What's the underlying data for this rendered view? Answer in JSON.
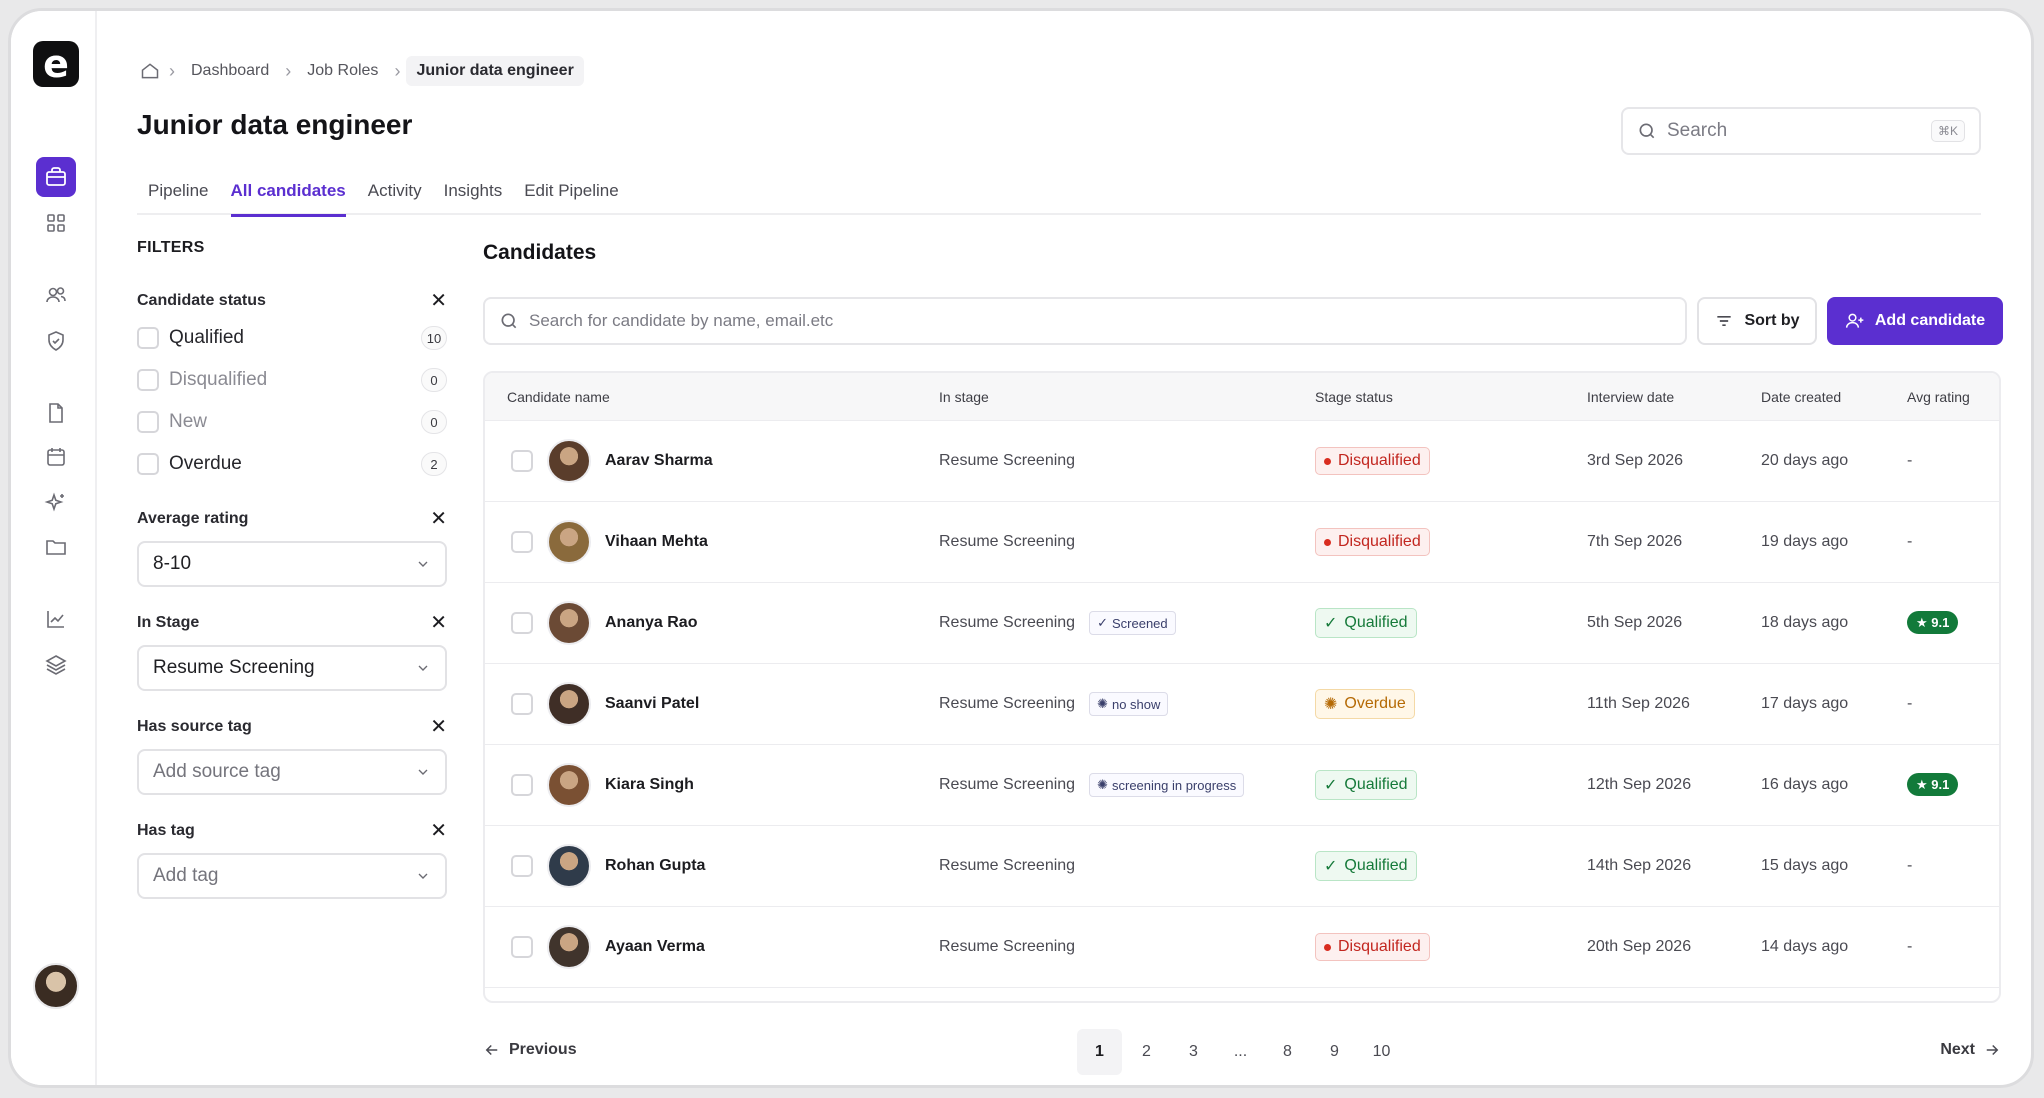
{
  "breadcrumb": {
    "items": [
      "Dashboard",
      "Job Roles",
      "Junior data engineer"
    ]
  },
  "page_title": "Junior data engineer",
  "search": {
    "placeholder": "Search",
    "shortcut": "⌘K"
  },
  "tabs": [
    "Pipeline",
    "All candidates",
    "Activity",
    "Insights",
    "Edit Pipeline"
  ],
  "active_tab": "All candidates",
  "filters": {
    "title": "FILTERS",
    "candidate_status": {
      "label": "Candidate status",
      "options": [
        {
          "label": "Qualified",
          "count": "10"
        },
        {
          "label": "Disqualified",
          "count": "0"
        },
        {
          "label": "New",
          "count": "0"
        },
        {
          "label": "Overdue",
          "count": "2"
        }
      ]
    },
    "average_rating": {
      "label": "Average rating",
      "value": "8-10"
    },
    "in_stage": {
      "label": "In Stage",
      "value": "Resume Screening"
    },
    "source_tag": {
      "label": "Has source tag",
      "placeholder": "Add source tag"
    },
    "tag": {
      "label": "Has tag",
      "placeholder": "Add tag"
    }
  },
  "candidates": {
    "title": "Candidates",
    "search_placeholder": "Search for candidate by name, email.etc",
    "sort_label": "Sort by",
    "add_label": "Add candidate",
    "columns": [
      "Candidate name",
      "In stage",
      "Stage status",
      "Interview date",
      "Date created",
      "Avg rating"
    ],
    "rows": [
      {
        "name": "Aarav Sharma",
        "stage": "Resume Screening",
        "tag": "",
        "status": "Disqualified",
        "interview": "3rd Sep 2026",
        "created": "20 days ago",
        "rating": "-"
      },
      {
        "name": "Vihaan Mehta",
        "stage": "Resume Screening",
        "tag": "",
        "status": "Disqualified",
        "interview": "7th Sep 2026",
        "created": "19 days ago",
        "rating": "-"
      },
      {
        "name": "Ananya Rao",
        "stage": "Resume Screening",
        "tag": "Screened",
        "status": "Qualified",
        "interview": "5th Sep 2026",
        "created": "18 days ago",
        "rating": "9.1"
      },
      {
        "name": "Saanvi Patel",
        "stage": "Resume Screening",
        "tag": "no show",
        "status": "Overdue",
        "interview": "11th Sep 2026",
        "created": "17 days ago",
        "rating": "-"
      },
      {
        "name": "Kiara Singh",
        "stage": "Resume Screening",
        "tag": "screening in progress",
        "status": "Qualified",
        "interview": "12th Sep 2026",
        "created": "16 days ago",
        "rating": "9.1"
      },
      {
        "name": "Rohan Gupta",
        "stage": "Resume Screening",
        "tag": "",
        "status": "Qualified",
        "interview": "14th Sep 2026",
        "created": "15 days ago",
        "rating": "-"
      },
      {
        "name": "Ayaan Verma",
        "stage": "Resume Screening",
        "tag": "",
        "status": "Disqualified",
        "interview": "20th Sep 2026",
        "created": "14 days ago",
        "rating": "-"
      }
    ]
  },
  "pagination": {
    "previous": "Previous",
    "next": "Next",
    "pages": [
      "1",
      "2",
      "3",
      "...",
      "8",
      "9",
      "10"
    ],
    "current": "1"
  },
  "colors": {
    "accent": "#5b2fd0",
    "qualified": "#167a3a",
    "disqualified": "#c2261f",
    "overdue": "#b56a05"
  },
  "sidebar_icons": [
    "jobs-icon",
    "grid-icon",
    "users-icon",
    "shield-icon",
    "document-icon",
    "calendar-icon",
    "sparkle-icon",
    "folder-icon",
    "chart-icon",
    "layers-icon"
  ]
}
